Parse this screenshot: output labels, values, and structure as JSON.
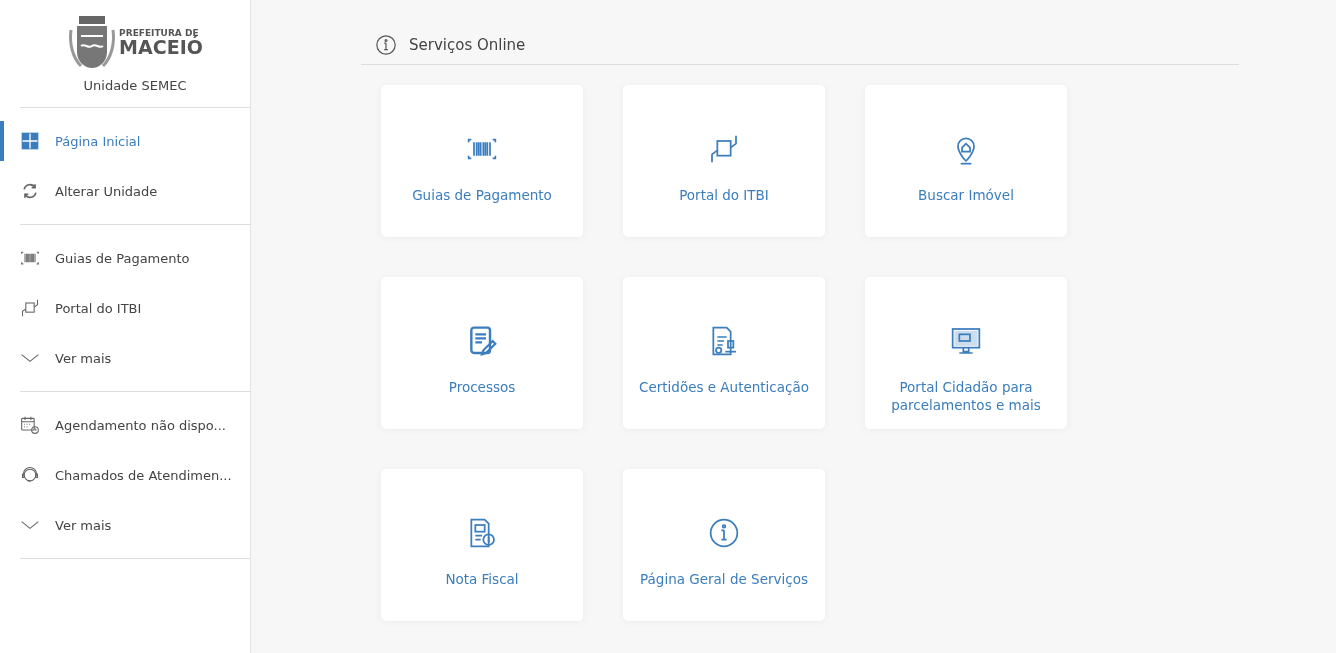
{
  "logo": {
    "line_1": "PREFEITURA DE",
    "line_2": "MACEIÓ"
  },
  "unit": "Unidade SEMEC",
  "sidebar": {
    "groups": [
      [
        {
          "kind": "grid",
          "label": "Página Inicial",
          "selected": true
        },
        {
          "kind": "refresh",
          "label": "Alterar Unidade",
          "selected": false
        }
      ],
      [
        {
          "kind": "barcode",
          "label": "Guias de Pagamento",
          "selected": false
        },
        {
          "kind": "handover",
          "label": "Portal do ITBI",
          "selected": false
        },
        {
          "kind": "chevron",
          "label": "Ver mais",
          "selected": false
        }
      ],
      [
        {
          "kind": "calendar",
          "label": "Agendamento não dispo...",
          "selected": false
        },
        {
          "kind": "headset",
          "label": "Chamados de Atendimen...",
          "selected": false
        },
        {
          "kind": "chevron",
          "label": "Ver mais",
          "selected": false
        }
      ]
    ]
  },
  "section": {
    "title": "Serviços Online"
  },
  "cards": [
    {
      "kind": "barcode",
      "label": "Guias de Pagamento"
    },
    {
      "kind": "handover",
      "label": "Portal do ITBI"
    },
    {
      "kind": "pin",
      "label": "Buscar Imóvel"
    },
    {
      "kind": "document",
      "label": "Processos"
    },
    {
      "kind": "certificate",
      "label": "Certidões e Autenticação"
    },
    {
      "kind": "monitor",
      "label": "Portal Cidadão para parcelamentos e mais"
    },
    {
      "kind": "invoice",
      "label": "Nota Fiscal"
    },
    {
      "kind": "info",
      "label": "Página Geral de Serviços"
    }
  ]
}
